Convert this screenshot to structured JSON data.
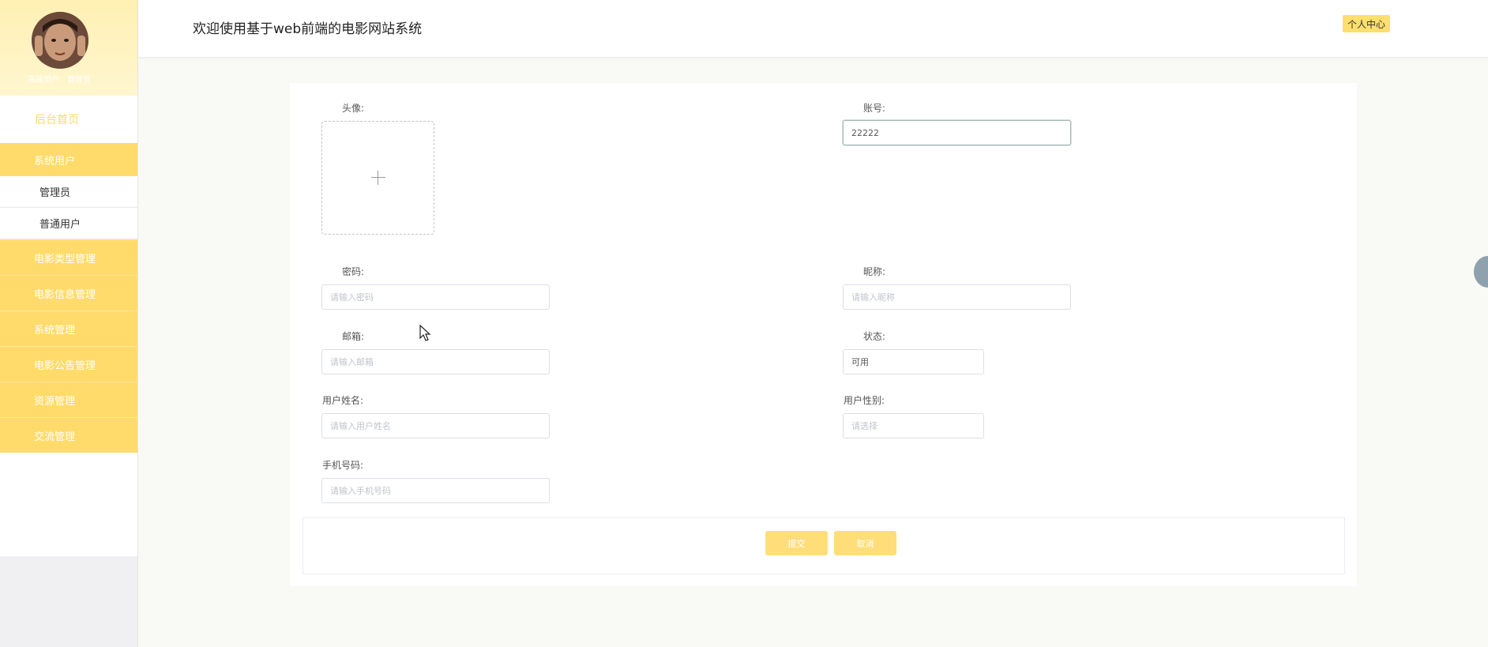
{
  "sidebar": {
    "user_role": "高级用户：管理员",
    "home": "后台首页",
    "group": "系统用户",
    "sub_items": [
      "管理员",
      "普通用户"
    ],
    "items": [
      "电影类型管理",
      "电影信息管理",
      "系统管理",
      "电影公告管理",
      "资源管理",
      "交流管理"
    ]
  },
  "header": {
    "title": "欢迎使用基于web前端的电影网站系统",
    "personal_center": "个人中心"
  },
  "form": {
    "avatar_label": "头像:",
    "account_label": "账号:",
    "account_value": "22222",
    "password_label": "密码:",
    "password_placeholder": "请输入密码",
    "nickname_label": "昵称:",
    "nickname_placeholder": "请输入昵称",
    "email_label": "邮箱:",
    "email_placeholder": "请输入邮箱",
    "status_label": "状态:",
    "status_value": "可用",
    "realname_label": "用户姓名:",
    "realname_placeholder": "请输入用户姓名",
    "gender_label": "用户性别:",
    "gender_placeholder": "请选择",
    "phone_label": "手机号码:",
    "phone_placeholder": "请输入手机号码",
    "submit": "提交",
    "cancel": "取消"
  },
  "colors": {
    "accent": "#ffdb6b",
    "button": "#ffde7a",
    "home_text": "#f9d86c"
  }
}
